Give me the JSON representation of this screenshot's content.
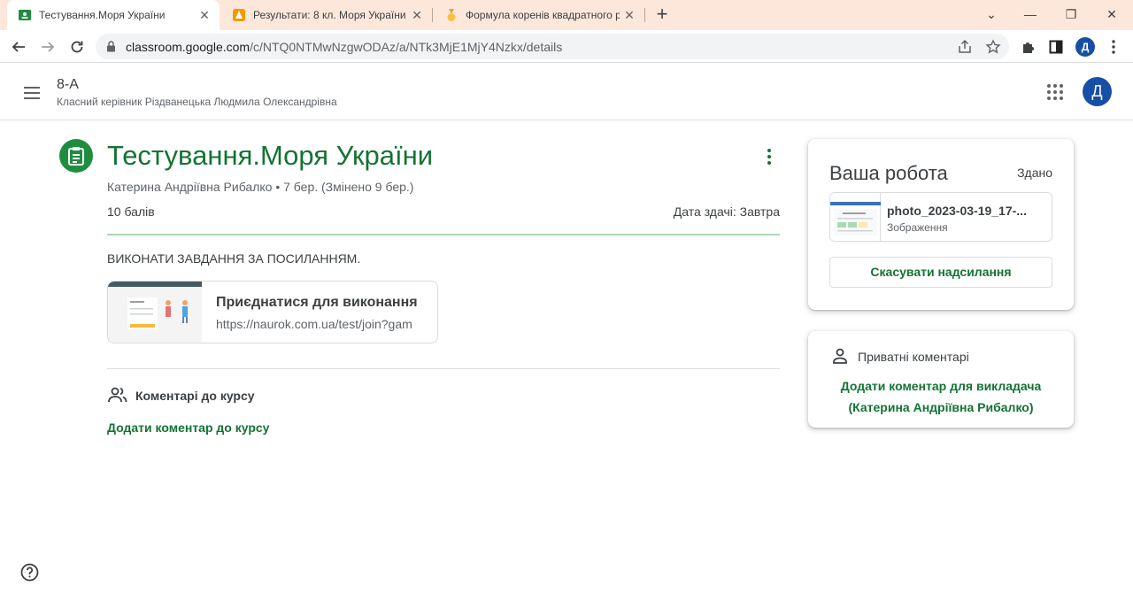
{
  "browser": {
    "tabs": [
      {
        "title": "Тестування.Моря України",
        "active": true
      },
      {
        "title": "Результати: 8 кл. Моря України",
        "active": false
      },
      {
        "title": "Формула коренів квадратного р",
        "active": false
      }
    ],
    "url_main": "classroom.google.com",
    "url_path": "/c/NTQ0NTMwNzgwODAz/a/NTk3MjE1MjY4Nzkx/details",
    "profile_initial": "Д"
  },
  "header": {
    "class_name": "8-А",
    "class_subtitle": "Класний керівник Різдванецька Людмила Олександрівна",
    "avatar_initial": "Д"
  },
  "assignment": {
    "title": "Тестування.Моря України",
    "meta": "Катерина Андріївна Рибалко • 7 бер. (Змінено 9 бер.)",
    "points": "10 балів",
    "due": "Дата здачі: Завтра",
    "instructions": "ВИКОНАТИ ЗАВДАННЯ ЗА ПОСИЛАННЯМ.",
    "link": {
      "title": "Приєднатися для виконання",
      "url": "https://naurok.com.ua/test/join?gam"
    }
  },
  "class_comments": {
    "heading": "Коментарі до курсу",
    "add_label": "Додати коментар до курсу"
  },
  "your_work": {
    "title": "Ваша робота",
    "status": "Здано",
    "file_name": "photo_2023-03-19_17-...",
    "file_type": "Зображення",
    "unsubmit_label": "Скасувати надсилання"
  },
  "private_comments": {
    "heading": "Приватні коментарі",
    "add_line1": "Додати коментар для викладача",
    "add_line2": "(Катерина Андріївна Рибалко)"
  },
  "colors": {
    "accent_green": "#137333",
    "tab_bar": "#fde7da",
    "avatar_blue": "#174ea6"
  }
}
